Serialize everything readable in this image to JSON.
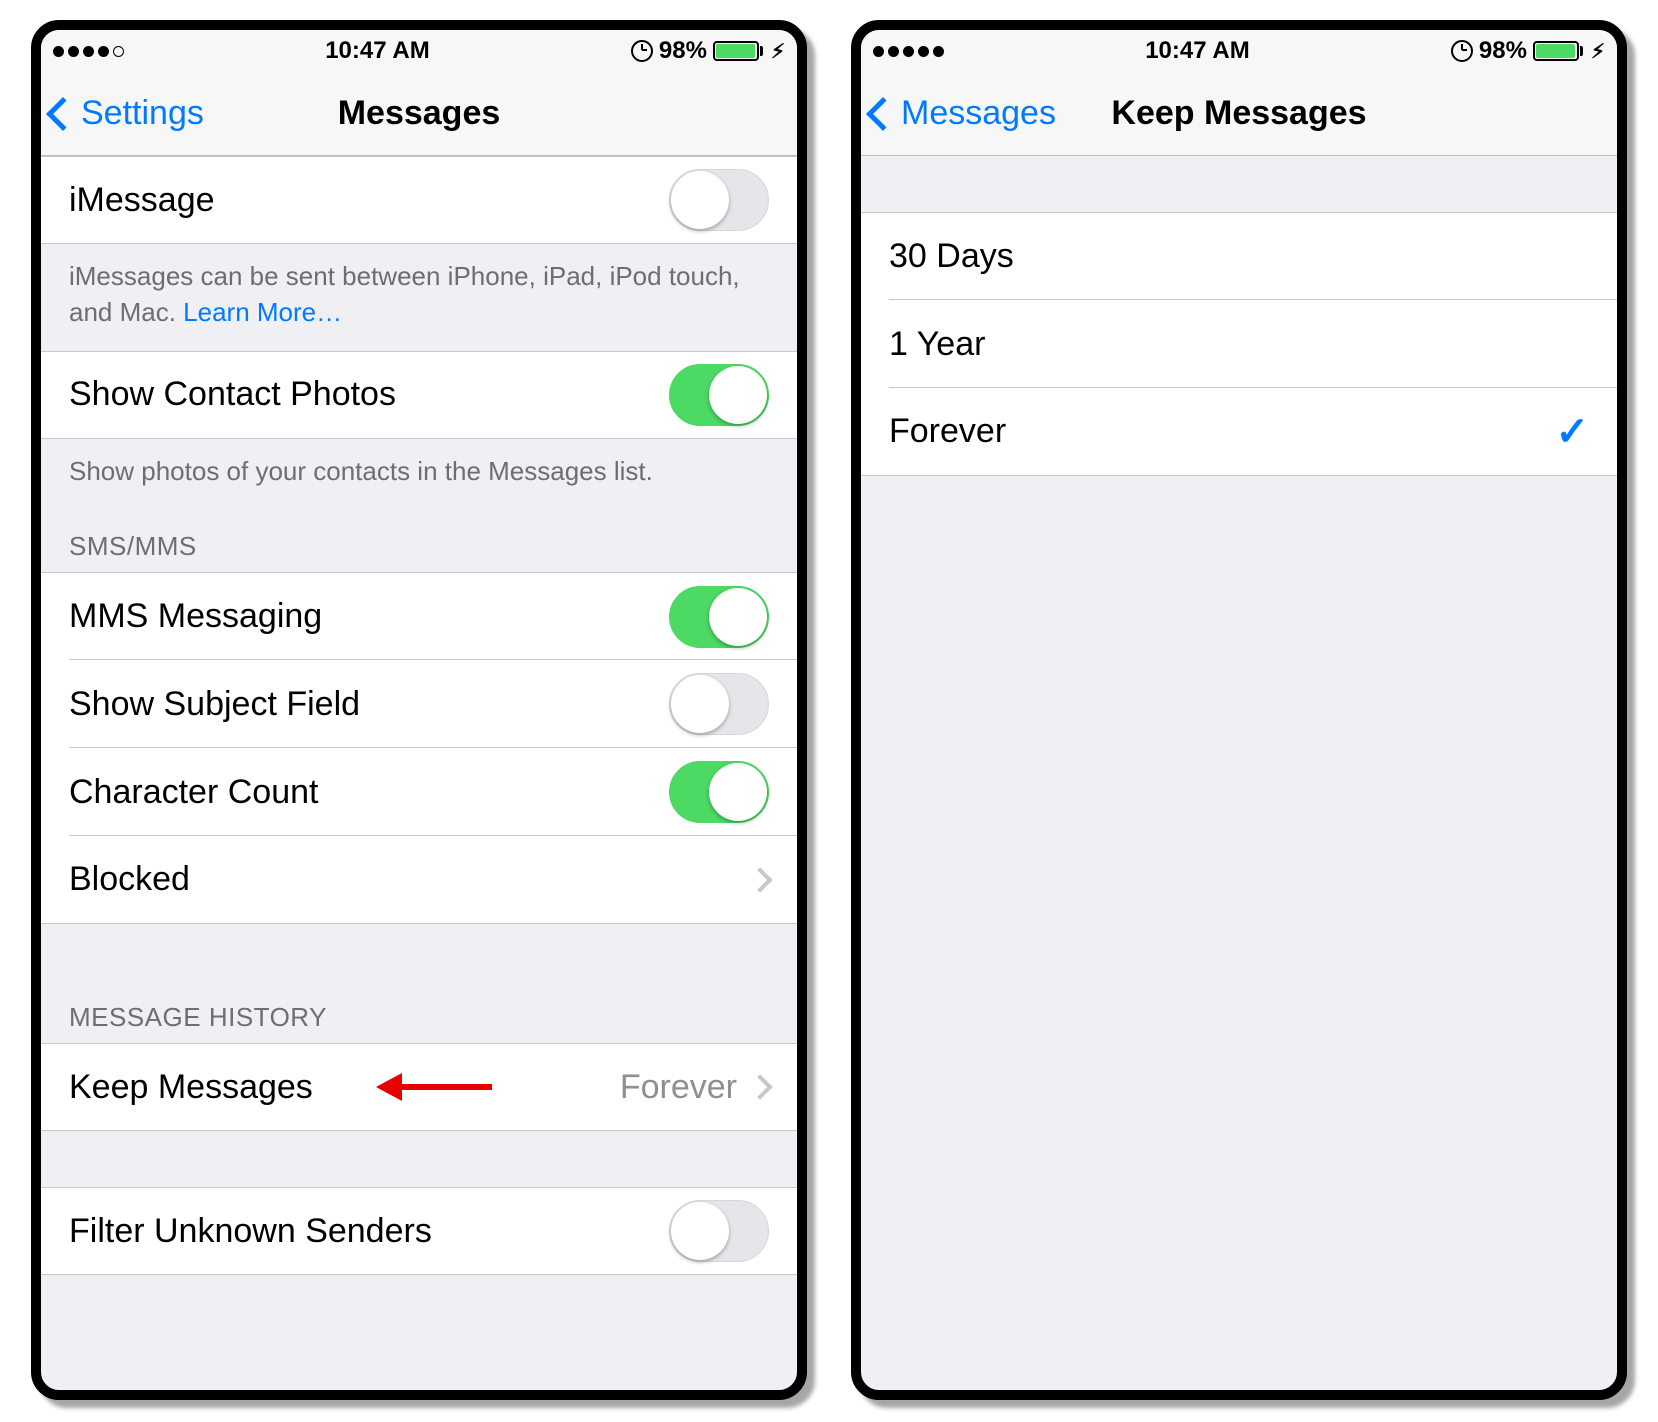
{
  "status": {
    "time": "10:47 AM",
    "battery_pct": "98%",
    "battery_fill_pct": 98,
    "signal_filled": 4,
    "signal_total": 5,
    "right_signal_filled": 5
  },
  "left": {
    "back_label": "Settings",
    "title": "Messages",
    "imessage_label": "iMessage",
    "imessage_on": false,
    "imessage_footer_a": "iMessages can be sent between iPhone, iPad, iPod touch, and Mac. ",
    "imessage_footer_link": "Learn More…",
    "contact_photos_label": "Show Contact Photos",
    "contact_photos_on": true,
    "contact_photos_footer": "Show photos of your contacts in the Messages list.",
    "sms_header": "SMS/MMS",
    "mms_label": "MMS Messaging",
    "mms_on": true,
    "subject_label": "Show Subject Field",
    "subject_on": false,
    "charcount_label": "Character Count",
    "charcount_on": true,
    "blocked_label": "Blocked",
    "history_header": "MESSAGE HISTORY",
    "keep_label": "Keep Messages",
    "keep_value": "Forever",
    "filter_label": "Filter Unknown Senders",
    "filter_on": false
  },
  "right": {
    "back_label": "Messages",
    "title": "Keep Messages",
    "options": [
      {
        "label": "30 Days",
        "selected": false
      },
      {
        "label": "1 Year",
        "selected": false
      },
      {
        "label": "Forever",
        "selected": true
      }
    ]
  }
}
